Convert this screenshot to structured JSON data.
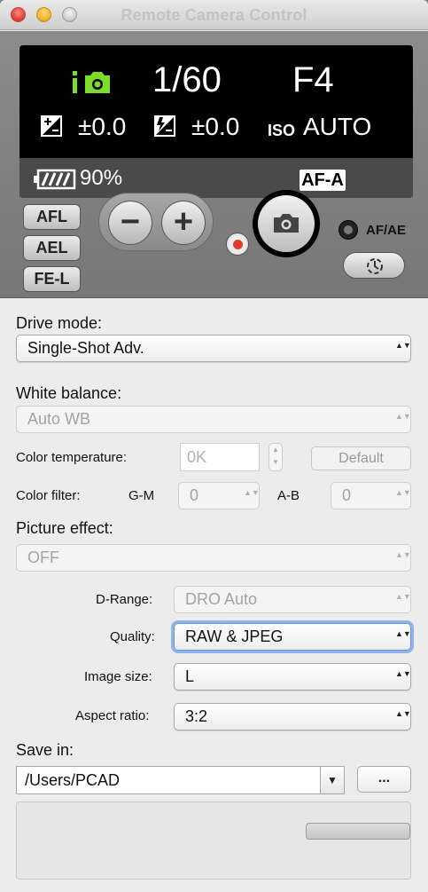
{
  "window": {
    "title": "Remote Camera Control"
  },
  "lcd": {
    "mode_icon": "intelligent-auto-camera-icon",
    "mode_icon_color": "#7fdb2a",
    "shutter_speed": "1/60",
    "aperture": "F4",
    "exposure_comp": "±0.0",
    "flash_comp": "±0.0",
    "iso_label": "ISO",
    "iso_value": "AUTO",
    "battery": "90%",
    "focus_mode": "AF-A"
  },
  "controls": {
    "afl": "AFL",
    "ael": "AEL",
    "fel": "FE-L",
    "zoom_out": "−",
    "zoom_in": "+",
    "afae_label": "AF/AE",
    "record_color": "#e23b2e"
  },
  "form": {
    "drive_mode": {
      "label": "Drive mode:",
      "value": "Single-Shot Adv."
    },
    "white_balance": {
      "label": "White balance:",
      "value": "Auto WB"
    },
    "color_temperature": {
      "label": "Color temperature:",
      "value": "0K",
      "default_button": "Default"
    },
    "color_filter": {
      "label": "Color filter:",
      "gm_label": "G-M",
      "gm_value": "0",
      "ab_label": "A-B",
      "ab_value": "0"
    },
    "picture_effect": {
      "label": "Picture effect:",
      "value": "OFF"
    },
    "d_range": {
      "label": "D-Range:",
      "value": "DRO Auto"
    },
    "quality": {
      "label": "Quality:",
      "value": "RAW & JPEG"
    },
    "image_size": {
      "label": "Image size:",
      "value": "L"
    },
    "aspect_ratio": {
      "label": "Aspect ratio:",
      "value": "3:2"
    },
    "save_in": {
      "label": "Save in:",
      "path": "/Users/PCAD",
      "browse_button": "..."
    }
  },
  "arrows": {
    "updown": "▲▼",
    "down": "▼"
  }
}
